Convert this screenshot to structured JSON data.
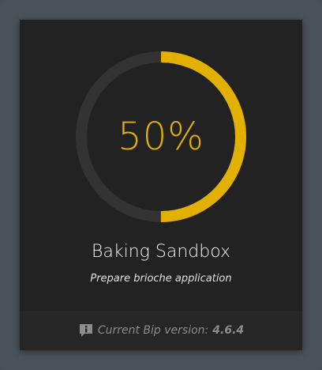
{
  "progress": {
    "value": 0.5,
    "label": "50%",
    "track_color": "#333333",
    "fill_color": "#e2b000"
  },
  "app": {
    "title": "Baking Sandbox",
    "subtitle": "Prepare brioche application"
  },
  "footer": {
    "icon": "info-speech-icon",
    "version_label": "Current Bip version:",
    "version": "4.6.4"
  }
}
